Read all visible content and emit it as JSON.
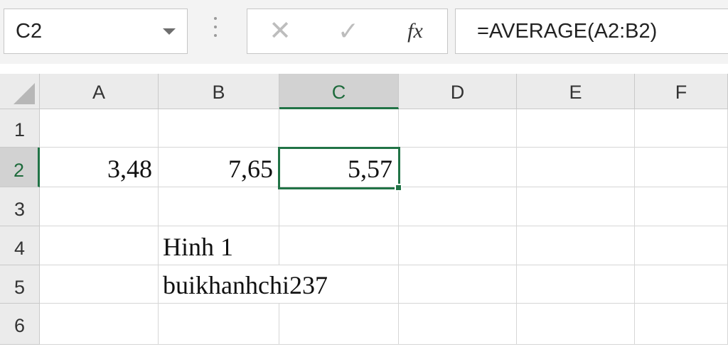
{
  "formula_bar": {
    "name_box": "C2",
    "cancel_symbol": "✕",
    "enter_symbol": "✓",
    "fx_label": "fx",
    "formula": "=AVERAGE(A2:B2)"
  },
  "columns": [
    "A",
    "B",
    "C",
    "D",
    "E",
    "F"
  ],
  "rows": [
    "1",
    "2",
    "3",
    "4",
    "5",
    "6"
  ],
  "cells": {
    "A2": "3,48",
    "B2": "7,65",
    "C2": "5,57",
    "B4": "Hinh 1",
    "B5": "buikhanhchi237"
  },
  "selection": {
    "active_cell": "C2",
    "accent_color": "#217346"
  }
}
